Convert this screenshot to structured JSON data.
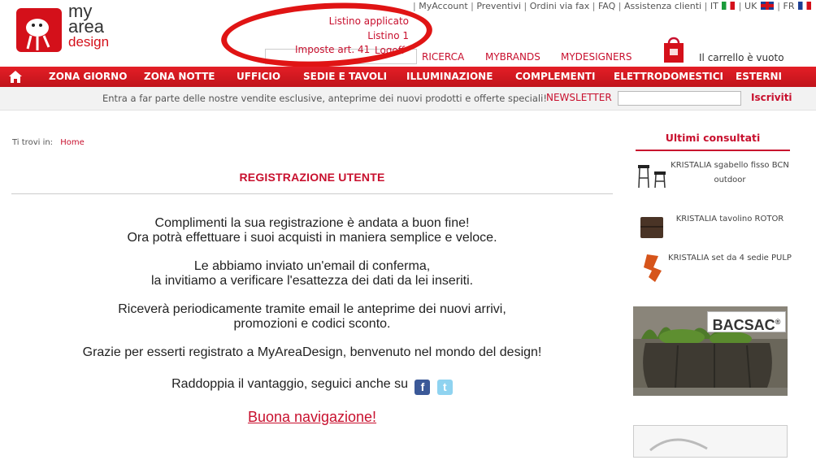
{
  "logo": {
    "line1": "my",
    "line2": "area",
    "line3": "design"
  },
  "toplinks": {
    "myaccount": "MyAccount",
    "preventivi": "Preventivi",
    "fax": "Ordini via fax",
    "faq": "FAQ",
    "assistenza": "Assistenza clienti",
    "lang_it": "IT",
    "lang_uk": "UK",
    "lang_fr": "FR",
    "sep": "|"
  },
  "price_info": {
    "applied": "Listino applicato",
    "list": "Listino 1",
    "tax": "Imposte art. 41",
    "logoff": "Logoff"
  },
  "secondary_nav": {
    "ricerca": "RICERCA",
    "mybrands": "MYBRANDS",
    "mydesigners": "MYDESIGNERS"
  },
  "cart": {
    "status": "Il carrello è vuoto"
  },
  "main_nav": [
    "ZONA GIORNO",
    "ZONA NOTTE",
    "UFFICIO",
    "SEDIE E TAVOLI",
    "ILLUMINAZIONE",
    "COMPLEMENTI",
    "ELETTRODOMESTICI",
    "ESTERNI"
  ],
  "newsletter": {
    "text": "Entra a far parte delle nostre vendite esclusive, anteprime dei nuovi prodotti e offerte speciali!",
    "label": "NEWSLETTER",
    "button": "Iscriviti"
  },
  "breadcrumb": {
    "prefix": "Ti trovi in:",
    "home": "Home"
  },
  "page": {
    "title": "REGISTRAZIONE UTENTE",
    "p1a": "Complimenti la sua registrazione è andata a buon fine!",
    "p1b": "Ora potrà effettuare i suoi acquisti in maniera semplice e veloce.",
    "p2a": "Le abbiamo inviato un'email di conferma,",
    "p2b": "la invitiamo a verificare l'esattezza dei dati da lei inseriti.",
    "p3a": "Riceverà periodicamente tramite email le anteprime dei nuovi arrivi,",
    "p3b": "promozioni e codici sconto.",
    "p4": "Grazie per esserti registrato a MyAreaDesign, benvenuto nel mondo del design!",
    "social": "Raddoppia il vantaggio, seguici anche su",
    "goodnav": "Buona navigazione!"
  },
  "sidebar": {
    "title": "Ultimi consultati",
    "items": [
      {
        "label": "KRISTALIA sgabello fisso BCN outdoor"
      },
      {
        "label": "KRISTALIA tavolino ROTOR"
      },
      {
        "label": "KRISTALIA set da 4 sedie PULP"
      }
    ],
    "banner_brand": "BACSAC",
    "banner_mark": "®"
  },
  "colors": {
    "brand_red": "#c8102e",
    "nav_red": "#d4101a",
    "annotation_red": "#e01414"
  }
}
